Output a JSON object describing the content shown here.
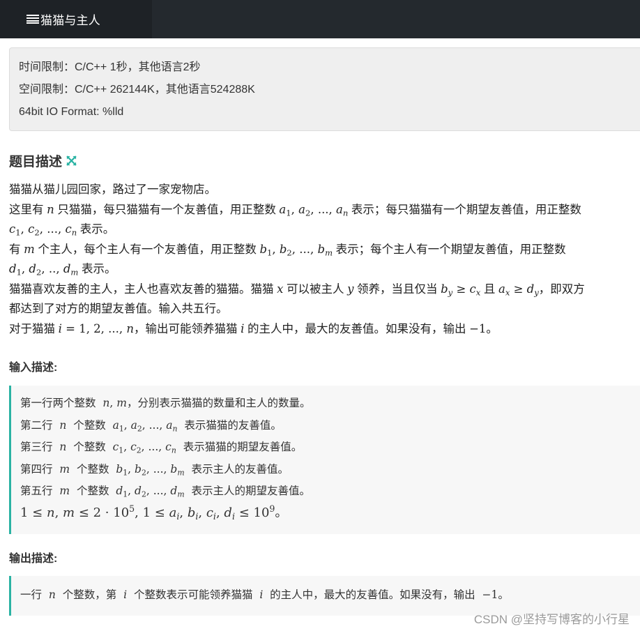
{
  "tab": {
    "title": "猫猫与主人",
    "icon": "list-icon"
  },
  "limits": {
    "time": "时间限制：C/C++ 1秒，其他语言2秒",
    "space": "空间限制：C/C++ 262144K，其他语言524288K",
    "io": "64bit IO Format: %lld"
  },
  "problem": {
    "heading": "题目描述",
    "heading_icon": "expand-icon",
    "l1": "猫猫从猫儿园回家，路过了一家宠物店。",
    "l2a": "这里有",
    "l2b": "只猫猫，每只猫猫有一个友善值，用正整数",
    "l2c": "表示；每只猫猫有一个期望友善值，用正整数",
    "l3": "表示。",
    "l4a": "有",
    "l4b": "个主人，每个主人有一个友善值，用正整数",
    "l4c": "表示；每个主人有一个期望友善值，用正整数",
    "l5": "表示。",
    "l6a": "猫猫喜欢友善的主人，主人也喜欢友善的猫猫。猫猫",
    "l6b": "可以被主人",
    "l6c": "领养，当且仅当",
    "l6d": "且",
    "l6e": "，即双方",
    "l7": "都达到了对方的期望友善值。输入共五行。",
    "l8a": "对于猫猫",
    "l8b": "，输出可能领养猫猫",
    "l8c": "的主人中，最大的友善值。如果没有，输出",
    "l8d": "。"
  },
  "input": {
    "heading": "输入描述:",
    "r1a": "第一行两个整数",
    "r1b": "，分别表示猫猫的数量和主人的数量。",
    "r2a": "第二行",
    "r2b": "个整数",
    "r2c": "表示猫猫的友善值。",
    "r3a": "第三行",
    "r3b": "个整数",
    "r3c": "表示猫猫的期望友善值。",
    "r4a": "第四行",
    "r4b": "个整数",
    "r4c": "表示主人的友善值。",
    "r5a": "第五行",
    "r5b": "个整数",
    "r5c": "表示主人的期望友善值。",
    "r6end": "。"
  },
  "output": {
    "heading": "输出描述:",
    "a": "一行",
    "b": "个整数，第",
    "c": "个整数表示可能领养猫猫",
    "d": "的主人中，最大的友善值。如果没有，输出",
    "e": "。"
  },
  "watermark": "CSDN @坚持写博客的小行星",
  "colors": {
    "topbar": "#24292e",
    "accent": "#2ab3a3",
    "panel": "#efefef"
  }
}
